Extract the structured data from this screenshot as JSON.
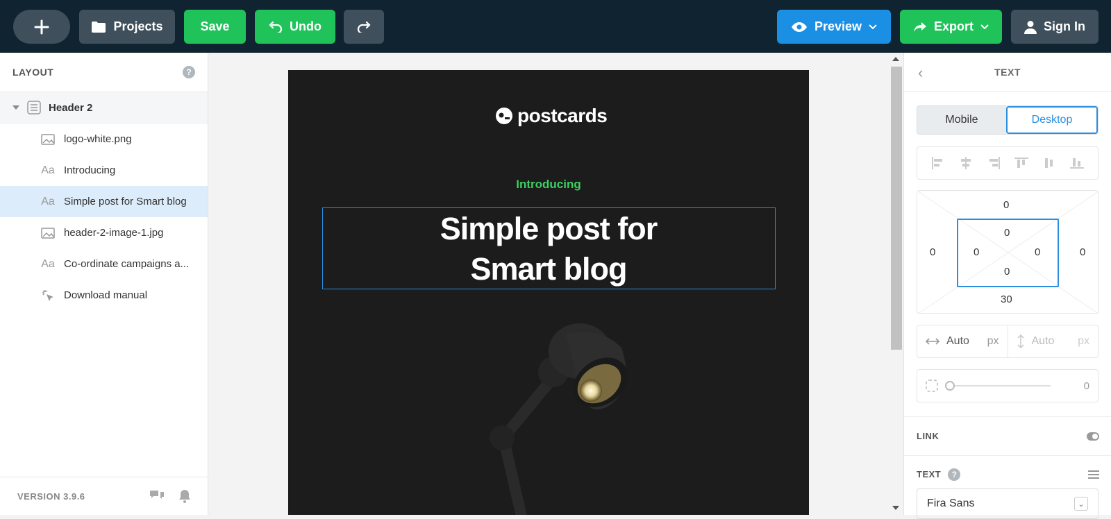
{
  "toolbar": {
    "projects_label": "Projects",
    "save_label": "Save",
    "undo_label": "Undo",
    "preview_label": "Preview",
    "export_label": "Export",
    "signin_label": "Sign In"
  },
  "sidebar": {
    "title": "LAYOUT",
    "help": "?",
    "group": "Header 2",
    "items": [
      {
        "label": "logo-white.png",
        "icon": "image-icon"
      },
      {
        "label": "Introducing",
        "icon": "text-icon"
      },
      {
        "label": "Simple post for Smart blog",
        "icon": "text-icon",
        "selected": true
      },
      {
        "label": "header-2-image-1.jpg",
        "icon": "image-icon"
      },
      {
        "label": "Co-ordinate campaigns a...",
        "icon": "text-icon"
      },
      {
        "label": "Download manual",
        "icon": "click-icon"
      }
    ],
    "version": "VERSION 3.9.6"
  },
  "email": {
    "logo_text": "postcards",
    "intro": "Introducing",
    "headline_line1": "Simple post for",
    "headline_line2": "Smart blog"
  },
  "panel": {
    "title": "TEXT",
    "mode_mobile": "Mobile",
    "mode_desktop": "Desktop",
    "margin": {
      "top": "0",
      "left": "0",
      "right": "0",
      "bottom": "30"
    },
    "padding": {
      "top": "0",
      "left": "0",
      "right": "0",
      "bottom": "0"
    },
    "width": "Auto",
    "height": "Auto",
    "unit": "px",
    "radius": "0",
    "link_label": "LINK",
    "text_label": "TEXT",
    "font": "Fira Sans"
  },
  "colors": {
    "accent_blue": "#1a8fe3",
    "accent_green": "#20c35a",
    "topbar": "#0f2430",
    "email_bg": "#1c1c1c",
    "intro_green": "#3ccf62"
  }
}
